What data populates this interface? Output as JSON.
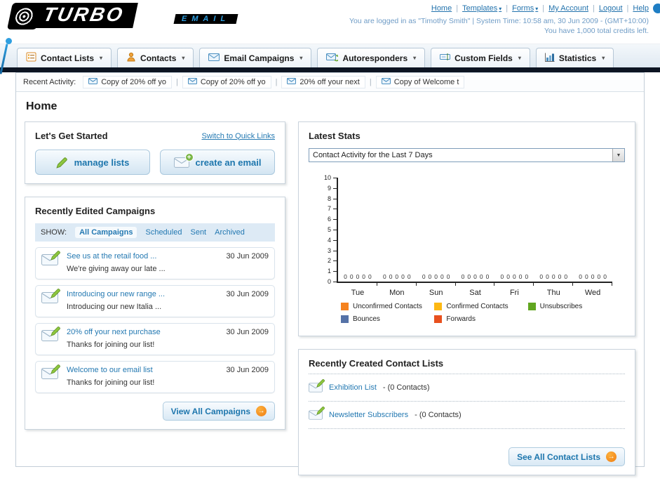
{
  "header": {
    "logo_line1": "TURBO",
    "logo_line2": "EMAIL",
    "nav": [
      {
        "label": "Home"
      },
      {
        "label": "Templates"
      },
      {
        "label": "Forms"
      },
      {
        "label": "My Account"
      },
      {
        "label": "Logout"
      },
      {
        "label": "Help"
      }
    ],
    "login_info": "You are logged in as \"Timothy Smith\" | System Time: 10:58 am, 30 Jun 2009 - (GMT+10:00)",
    "credits_info": "You have 1,000 total credits left."
  },
  "tabs": [
    {
      "label": "Contact Lists"
    },
    {
      "label": "Contacts"
    },
    {
      "label": "Email Campaigns"
    },
    {
      "label": "Autoresponders"
    },
    {
      "label": "Custom Fields"
    },
    {
      "label": "Statistics"
    }
  ],
  "recent_activity": {
    "label": "Recent Activity:",
    "items": [
      {
        "label": "Copy of 20% off yo"
      },
      {
        "label": "Copy of 20% off yo"
      },
      {
        "label": "20% off your next"
      },
      {
        "label": "Copy of Welcome t"
      }
    ]
  },
  "page_title": "Home",
  "get_started": {
    "title": "Let's Get Started",
    "switch_link": "Switch to Quick Links",
    "manage_lists_label": "manage lists",
    "create_email_label": "create an email"
  },
  "campaigns": {
    "title": "Recently Edited Campaigns",
    "show_label": "SHOW:",
    "filters": [
      {
        "label": "All Campaigns"
      },
      {
        "label": "Scheduled"
      },
      {
        "label": "Sent"
      },
      {
        "label": "Archived"
      }
    ],
    "items": [
      {
        "title": "See us at the retail food ...",
        "subtitle": "We're giving away our late ...",
        "date": "30 Jun 2009"
      },
      {
        "title": "Introducing our new range ...",
        "subtitle": "Introducing our new Italia ...",
        "date": "30 Jun 2009"
      },
      {
        "title": "20% off your next purchase",
        "subtitle": "Thanks for joining our list!",
        "date": "30 Jun 2009"
      },
      {
        "title": "Welcome to our email list",
        "subtitle": "Thanks for joining our list!",
        "date": "30 Jun 2009"
      }
    ],
    "view_all_label": "View All Campaigns"
  },
  "stats": {
    "title": "Latest Stats",
    "period_selected": "Contact Activity for the Last 7 Days"
  },
  "chart_data": {
    "type": "bar",
    "title": "Contact Activity for the Last 7 Days",
    "categories": [
      "Tue",
      "Mon",
      "Sun",
      "Sat",
      "Fri",
      "Thu",
      "Wed"
    ],
    "series": [
      {
        "name": "Unconfirmed Contacts",
        "color": "#f5821f",
        "values": [
          0,
          0,
          0,
          0,
          0,
          0,
          0
        ]
      },
      {
        "name": "Confirmed Contacts",
        "color": "#fdb813",
        "values": [
          0,
          0,
          0,
          0,
          0,
          0,
          0
        ]
      },
      {
        "name": "Unsubscribes",
        "color": "#61a620",
        "values": [
          0,
          0,
          0,
          0,
          0,
          0,
          0
        ]
      },
      {
        "name": "Bounces",
        "color": "#5572a7",
        "values": [
          0,
          0,
          0,
          0,
          0,
          0,
          0
        ]
      },
      {
        "name": "Forwards",
        "color": "#e8501e",
        "values": [
          0,
          0,
          0,
          0,
          0,
          0,
          0
        ]
      }
    ],
    "ylim": [
      0,
      10
    ],
    "xlabel": "",
    "ylabel": "",
    "grid": false,
    "legend_position": "bottom"
  },
  "contact_lists": {
    "title": "Recently Created Contact Lists",
    "items": [
      {
        "name": "Exhibition List",
        "count": "- (0 Contacts)"
      },
      {
        "name": "Newsletter Subscribers",
        "count": "- (0 Contacts)"
      }
    ],
    "see_all_label": "See All Contact Lists"
  }
}
